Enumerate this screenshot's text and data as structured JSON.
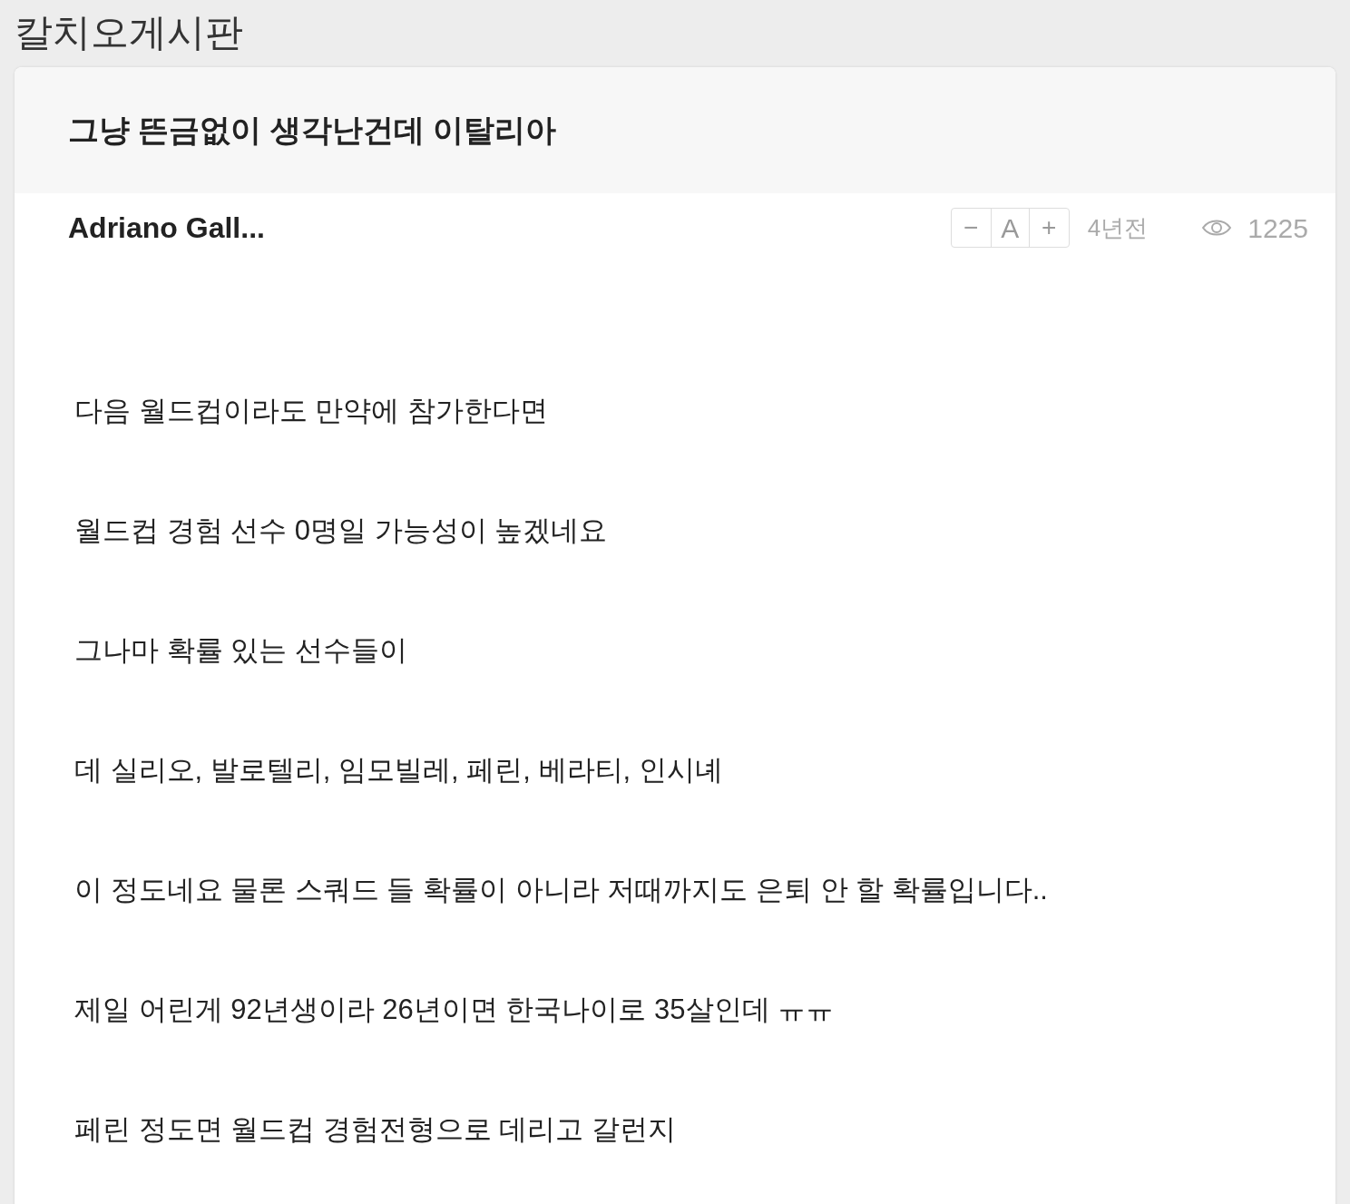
{
  "board_title": "칼치오게시판",
  "post": {
    "title": "그냥 뜬금없이 생각난건데 이탈리아",
    "author": "Adriano Gall...",
    "font_controls": [
      "−",
      "A",
      "+"
    ],
    "time": "4년전",
    "views": "1225",
    "paragraphs": [
      "다음 월드컵이라도 만약에 참가한다면",
      "월드컵 경험 선수 0명일 가능성이 높겠네요",
      "그나마 확률 있는 선수들이",
      "데 실리오, 발로텔리, 임모빌레, 페린, 베라티, 인시녜",
      "이 정도네요 물론 스쿼드 들 확률이 아니라 저때까지도 은퇴 안 할 확률입니다..",
      "제일 어린게 92년생이라 26년이면 한국나이로 35살인데 ㅠㅠ",
      "페린 정도면 월드컵 경험전형으로 데리고 갈런지"
    ]
  }
}
